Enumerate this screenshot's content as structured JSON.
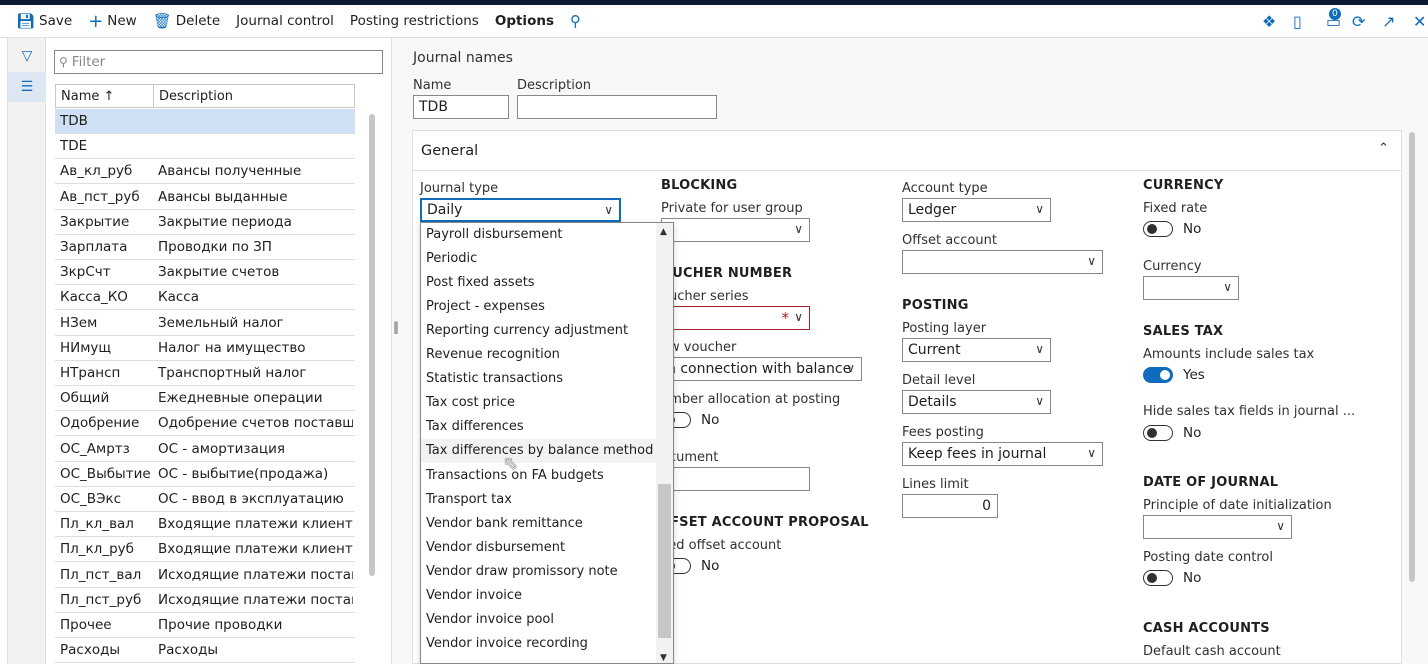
{
  "actions": {
    "save": "Save",
    "new": "New",
    "delete": "Delete",
    "journal_control": "Journal control",
    "posting_restrictions": "Posting restrictions",
    "options": "Options"
  },
  "badge_count": "0",
  "filter_placeholder": "Filter",
  "grid": {
    "col_name": "Name ↑",
    "col_description": "Description",
    "rows": [
      {
        "name": "TDB",
        "description": ""
      },
      {
        "name": "TDE",
        "description": ""
      },
      {
        "name": "Ав_кл_руб",
        "description": "Авансы полученные"
      },
      {
        "name": "Ав_пст_руб",
        "description": "Авансы выданные"
      },
      {
        "name": "Закрытие",
        "description": "Закрытие периода"
      },
      {
        "name": "Зарплата",
        "description": "Проводки по ЗП"
      },
      {
        "name": "ЗкрСчт",
        "description": "Закрытие счетов"
      },
      {
        "name": "Касса_КО",
        "description": "Касса"
      },
      {
        "name": "НЗем",
        "description": "Земельный налог"
      },
      {
        "name": "НИмущ",
        "description": "Налог на имущество"
      },
      {
        "name": "НТрансп",
        "description": "Транспортный налог"
      },
      {
        "name": "Общий",
        "description": "Ежедневные операции"
      },
      {
        "name": "Одобрение",
        "description": "Одобрение счетов поставщ..."
      },
      {
        "name": "ОС_Амртз",
        "description": "ОС - амортизация"
      },
      {
        "name": "ОС_Выбытие",
        "description": "ОС - выбытие(продажа)"
      },
      {
        "name": "ОС_ВЭкс",
        "description": "ОС - ввод в эксплуатацию"
      },
      {
        "name": "Пл_кл_вал",
        "description": "Входящие платежи клиенто..."
      },
      {
        "name": "Пл_кл_руб",
        "description": "Входящие платежи клиентов"
      },
      {
        "name": "Пл_пст_вал",
        "description": "Исходящие платежи постав..."
      },
      {
        "name": "Пл_пст_руб",
        "description": "Исходящие платежи постав..."
      },
      {
        "name": "Прочее",
        "description": "Прочие проводки"
      },
      {
        "name": "Расходы",
        "description": "Расходы"
      }
    ]
  },
  "detail": {
    "page_title": "Journal names",
    "name_label": "Name",
    "name_value": "TDB",
    "description_label": "Description",
    "description_value": "",
    "general_title": "General",
    "journal_type_label": "Journal type",
    "journal_type_value": "Daily",
    "blocking_title": "BLOCKING",
    "private_group_label": "Private for user group",
    "voucher_number_title": "OUCHER NUMBER",
    "voucher_series_label": "oucher series",
    "new_voucher_label": "ew voucher",
    "new_voucher_value": "n connection with balance",
    "number_alloc_label": "umber allocation at posting",
    "number_alloc_value": "No",
    "document_label": "ocument",
    "offset_proposal_title": "FFSET ACCOUNT PROPOSAL",
    "fixed_offset_label": "xed offset account",
    "fixed_offset_value": "No",
    "account_type_label": "Account type",
    "account_type_value": "Ledger",
    "offset_account_label": "Offset account",
    "posting_title": "POSTING",
    "posting_layer_label": "Posting layer",
    "posting_layer_value": "Current",
    "detail_level_label": "Detail level",
    "detail_level_value": "Details",
    "fees_posting_label": "Fees posting",
    "fees_posting_value": "Keep fees in journal",
    "lines_limit_label": "Lines limit",
    "lines_limit_value": "0",
    "currency_title": "CURRENCY",
    "fixed_rate_label": "Fixed rate",
    "fixed_rate_value": "No",
    "currency_label": "Currency",
    "sales_tax_title": "SALES TAX",
    "amounts_incl_label": "Amounts include sales tax",
    "amounts_incl_value": "Yes",
    "hide_fields_label": "Hide sales tax fields in journal ...",
    "hide_fields_value": "No",
    "date_journal_title": "DATE OF JOURNAL",
    "principle_date_label": "Principle of date initialization",
    "posting_date_control_label": "Posting date control",
    "posting_date_control_value": "No",
    "cash_accounts_title": "CASH ACCOUNTS",
    "default_cash_label": "Default cash account"
  },
  "dropdown_items": [
    "Payroll disbursement",
    "Periodic",
    "Post fixed assets",
    "Project - expenses",
    "Reporting currency adjustment",
    "Revenue recognition",
    "Statistic transactions",
    "Tax cost price",
    "Tax differences",
    "Tax differences by balance method",
    "Transactions on FA budgets",
    "Transport tax",
    "Vendor bank remittance",
    "Vendor disbursement",
    "Vendor draw promissory note",
    "Vendor invoice",
    "Vendor invoice pool",
    "Vendor invoice recording"
  ],
  "colors": {
    "accent": "#0f6cbd",
    "selected_row": "#cfe0f4",
    "required": "#a4262c"
  }
}
